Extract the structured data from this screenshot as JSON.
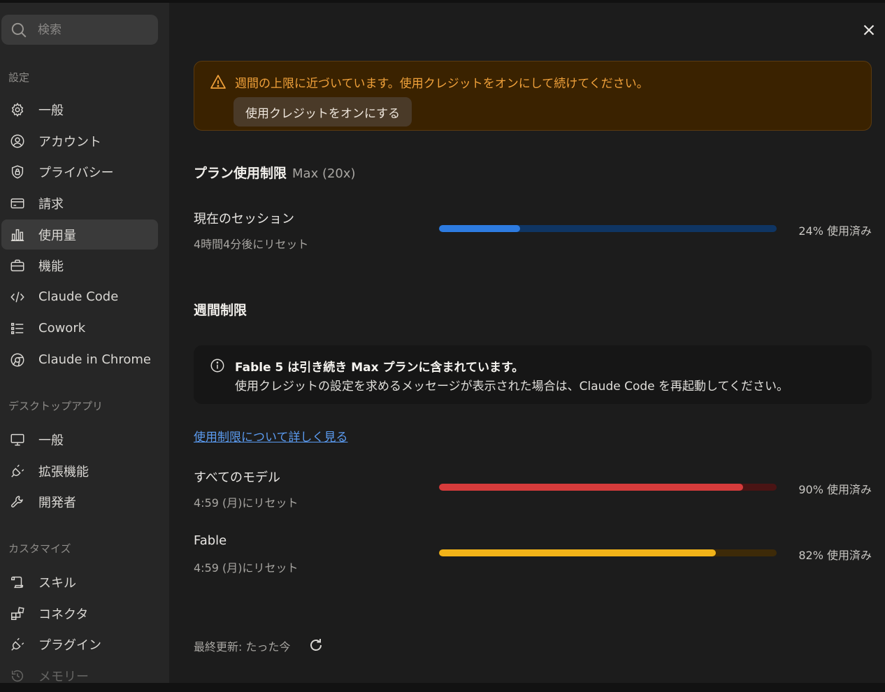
{
  "search": {
    "placeholder": "検索",
    "icon": "search-icon"
  },
  "sidebar": {
    "settings_label": "設定",
    "settings_items": [
      {
        "label": "一般",
        "icon": "gear-icon"
      },
      {
        "label": "アカウント",
        "icon": "user-circle-icon"
      },
      {
        "label": "プライバシー",
        "icon": "shield-lock-icon"
      },
      {
        "label": "請求",
        "icon": "credit-card-icon"
      },
      {
        "label": "使用量",
        "icon": "bar-chart-icon",
        "active": true
      },
      {
        "label": "機能",
        "icon": "toolbox-icon"
      },
      {
        "label": "Claude Code",
        "icon": "code-icon"
      },
      {
        "label": "Cowork",
        "icon": "list-icon"
      },
      {
        "label": "Claude in Chrome",
        "icon": "globe-icon"
      }
    ],
    "desktop_label": "デスクトップアプリ",
    "desktop_items": [
      {
        "label": "一般",
        "icon": "monitor-icon"
      },
      {
        "label": "拡張機能",
        "icon": "plug-icon"
      },
      {
        "label": "開発者",
        "icon": "wrench-icon"
      }
    ],
    "customize_label": "カスタマイズ",
    "customize_items": [
      {
        "label": "スキル",
        "icon": "scroll-icon"
      },
      {
        "label": "コネクタ",
        "icon": "blocks-icon"
      },
      {
        "label": "プラグイン",
        "icon": "plug-icon"
      },
      {
        "label": "メモリー",
        "icon": "history-icon"
      }
    ]
  },
  "alert": {
    "message": "週間の上限に近づいています。使用クレジットをオンにして続けてください。",
    "button": "使用クレジットをオンにする",
    "icon": "warning-icon",
    "color": "#f0a13a"
  },
  "plan": {
    "title": "プラン使用制限",
    "subtitle": "Max (20x)"
  },
  "session": {
    "title": "現在のセッション",
    "reset": "4時間4分後にリセット",
    "percent": 0.24,
    "percent_label": "24% 使用済み",
    "color": "#2d7be0",
    "track_color": "#0f3563"
  },
  "weekly": {
    "heading": "週間制限",
    "info_line1": "Fable 5 は引き続き Max プランに含まれています。",
    "info_line2": "使用クレジットの設定を求めるメッセージが表示された場合は、Claude Code を再起動してください。",
    "info_icon": "info-icon",
    "learn_more": "使用制限について詳しく見る",
    "all_models": {
      "title": "すべてのモデル",
      "reset": "4:59 (月)にリセット",
      "percent": 0.9,
      "percent_label": "90% 使用済み",
      "color": "#d63b3b",
      "track_color": "#4a1414"
    },
    "fable": {
      "title": "Fable",
      "reset": "4:59 (月)にリセット",
      "percent": 0.82,
      "percent_label": "82% 使用済み",
      "color": "#f2b318",
      "track_color": "#3d2a08"
    }
  },
  "footer": {
    "updated": "最終更新: たった今",
    "refresh_icon": "refresh-icon"
  }
}
